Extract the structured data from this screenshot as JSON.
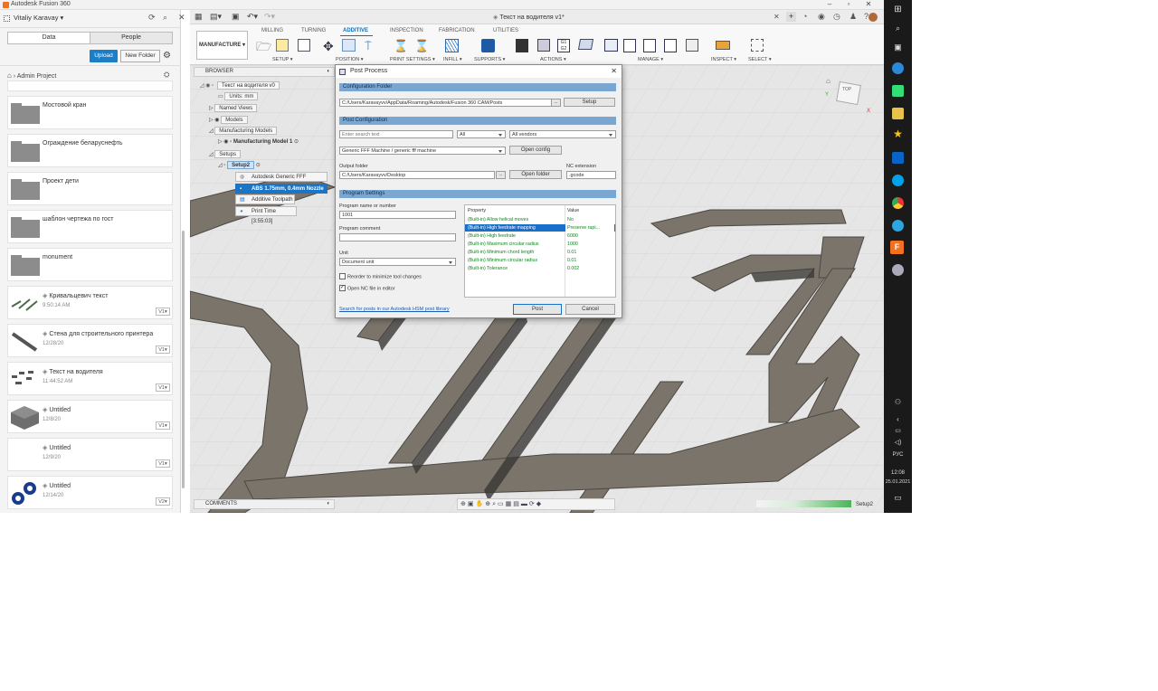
{
  "app": {
    "title": "Autodesk Fusion 360",
    "document_title": "Текст на водителя v1*"
  },
  "data_panel": {
    "user": "Vitaliy Karavay",
    "tabs": [
      "Data",
      "People"
    ],
    "upload_label": "Upload",
    "new_folder_label": "New Folder",
    "breadcrumb": "Admin Project",
    "items": [
      {
        "name": "Мостовой кран",
        "date": "",
        "version": "",
        "kind": "folder"
      },
      {
        "name": "Ограждение беларуснефть",
        "date": "",
        "version": "",
        "kind": "folder"
      },
      {
        "name": "Проект дети",
        "date": "",
        "version": "",
        "kind": "folder"
      },
      {
        "name": "шаблон чертежа по гост",
        "date": "",
        "version": "",
        "kind": "folder"
      },
      {
        "name": "monument",
        "date": "",
        "version": "",
        "kind": "folder"
      },
      {
        "name": "Кривальцевич текст",
        "date": "9:50:14 AM",
        "version": "V1",
        "kind": "design"
      },
      {
        "name": "Стена для строительного принтера",
        "date": "12/28/20",
        "version": "V1",
        "kind": "design"
      },
      {
        "name": "Текст на водителя",
        "date": "11:44:52 AM",
        "version": "V1",
        "kind": "design"
      },
      {
        "name": "Untitled",
        "date": "12/8/20",
        "version": "V1",
        "kind": "design"
      },
      {
        "name": "Untitled",
        "date": "12/9/20",
        "version": "V1",
        "kind": "design"
      },
      {
        "name": "Untitled",
        "date": "12/14/20",
        "version": "V2",
        "kind": "design"
      }
    ]
  },
  "toolbar": {
    "workspace": "MANUFACTURE",
    "tabs": [
      "MILLING",
      "TURNING",
      "ADDITIVE",
      "INSPECTION",
      "FABRICATION",
      "UTILITIES"
    ],
    "active_tab": "ADDITIVE",
    "groups": [
      "SETUP",
      "POSITION",
      "PRINT SETTINGS",
      "INFILL",
      "SUPPORTS",
      "ACTIONS",
      "MANAGE",
      "INSPECT",
      "SELECT"
    ]
  },
  "browser": {
    "title": "BROWSER",
    "root": "Текст на водителя v0",
    "units": "Units: mm",
    "named_views": "Named Views",
    "models": "Models",
    "manufacturing_models": "Manufacturing Models",
    "manufacturing_model_1": "Manufacturing Model 1",
    "setups": "Setups",
    "setup2": "Setup2",
    "machine": "Autodesk Generic FFF Machine",
    "material": "ABS 1.75mm, 0.4mm Nozzle",
    "toolpath": "Additive Toolpath",
    "print_time": "Print Time [3:55:03]"
  },
  "dialog": {
    "title": "Post Process",
    "config_folder_header": "Configuration Folder",
    "config_folder_path": "C:/Users/Karavayvv/AppData/Roaming/Autodesk/Fusion 360 CAM/Posts",
    "setup_button": "Setup",
    "post_config_header": "Post Configuration",
    "search_placeholder": "Enter search text",
    "filter_all": "All",
    "vendors": "All vendors",
    "machine": "Generic FFF Machine / generic fff machine",
    "open_config": "Open config",
    "output_folder_label": "Output folder",
    "output_folder": "C:/Users/Karavayvv/Desktop",
    "open_folder": "Open folder",
    "nc_ext_label": "NC extension",
    "nc_ext": ".gcode",
    "program_settings_header": "Program Settings",
    "program_name_label": "Program name or number",
    "program_name": "1001",
    "program_comment_label": "Program comment",
    "program_comment": "",
    "unit_label": "Unit",
    "unit": "Document unit",
    "reorder_label": "Reorder to minimize tool changes",
    "reorder_checked": false,
    "open_nc_label": "Open NC file in editor",
    "open_nc_checked": true,
    "link": "Search for posts in our Autodesk HSM post library",
    "post_button": "Post",
    "cancel_button": "Cancel",
    "table_headers": [
      "Property",
      "Value"
    ],
    "properties": [
      {
        "name": "(Built-in) Allow helical moves",
        "value": "No"
      },
      {
        "name": "(Built-in) High feedrate mapping",
        "value": "Preserve rapi...",
        "selected": true
      },
      {
        "name": "(Built-in) High feedrate",
        "value": "6000"
      },
      {
        "name": "(Built-in) Maximum circular radius",
        "value": "1000"
      },
      {
        "name": "(Built-in) Minimum chord length",
        "value": "0.01"
      },
      {
        "name": "(Built-in) Minimum circular radius",
        "value": "0.01"
      },
      {
        "name": "(Built-in) Tolerance",
        "value": "0.002"
      }
    ]
  },
  "viewcube": {
    "face": "TOP"
  },
  "comments_label": "COMMENTS",
  "status": {
    "setup": "Setup2"
  },
  "taskbar": {
    "language": "РУС",
    "time": "12:08",
    "date": "25.01.2021"
  }
}
